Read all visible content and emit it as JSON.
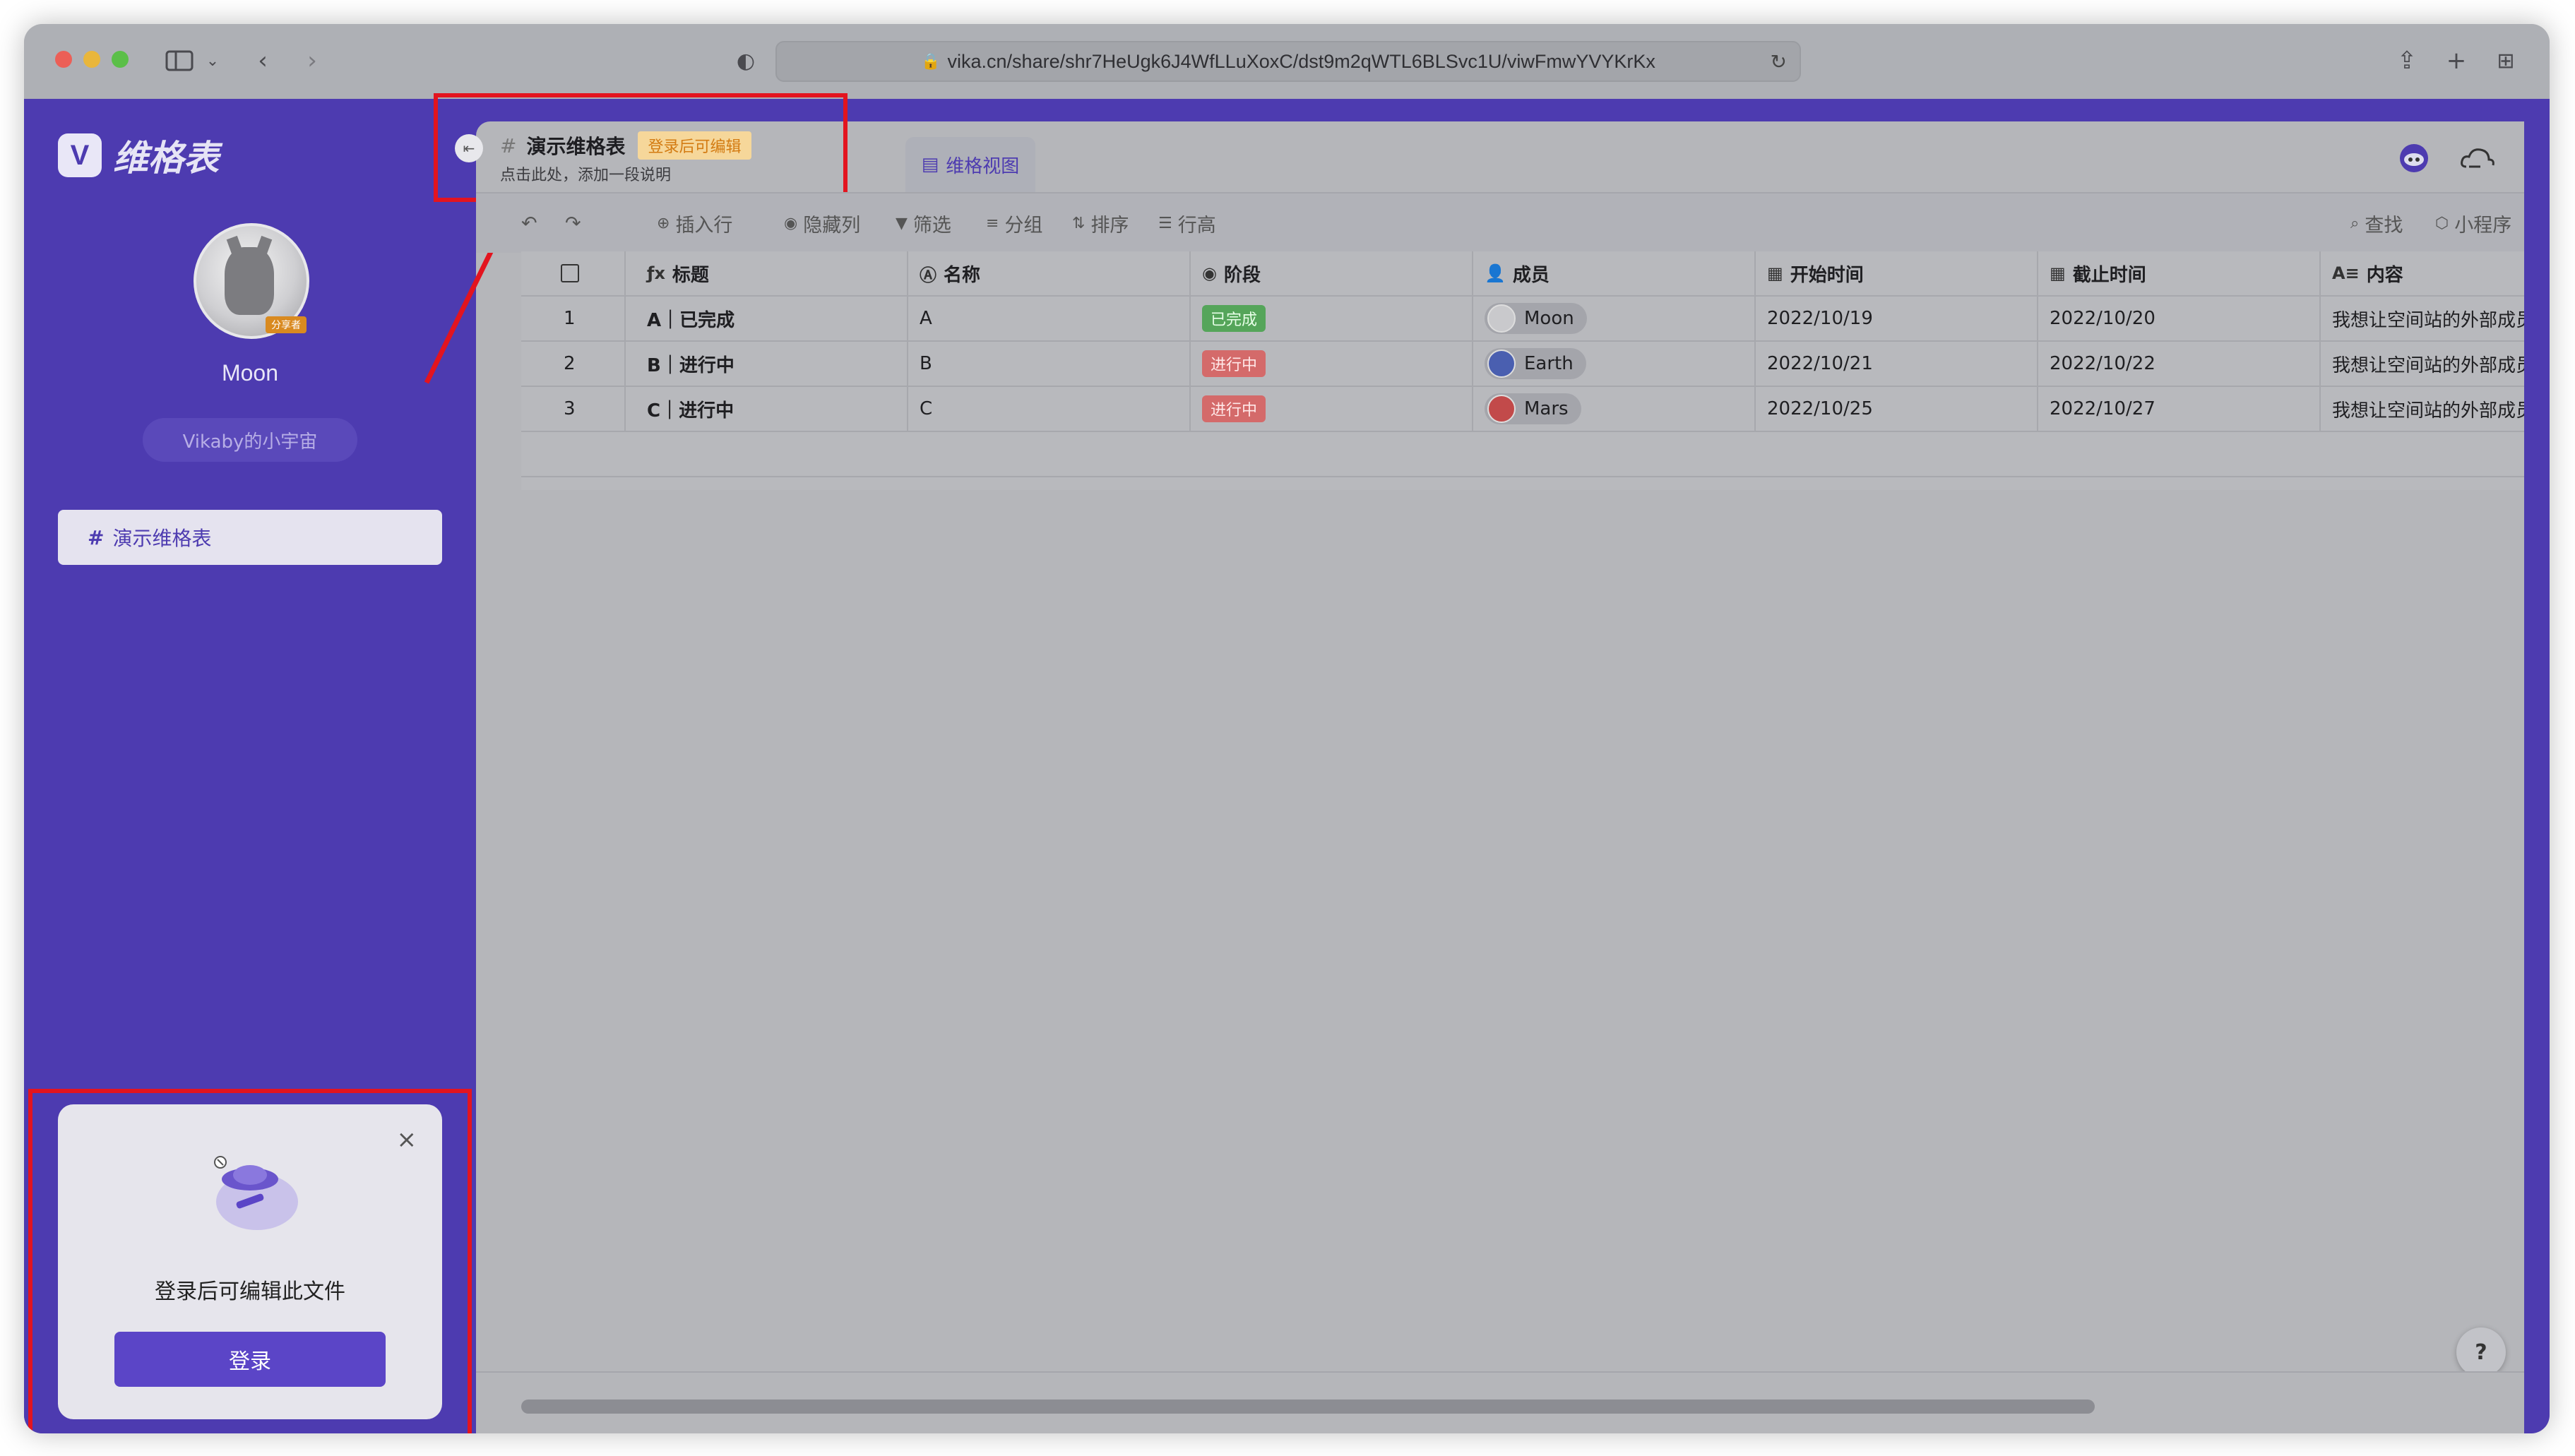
{
  "browser": {
    "url": "vika.cn/share/shr7HeUgk6J4WfLLuXoxC/dst9m2qWTL6BLSvc1U/viwFmwYVYKrKx",
    "traffic_colors": [
      "#ec5f57",
      "#e9b63b",
      "#5bbf48"
    ]
  },
  "sidebar": {
    "logo_text": "维格表",
    "logo_mark": "V",
    "avatar_badge": "分享者",
    "user_name": "Moon",
    "space_name": "Vikaby的小宇宙",
    "items": [
      {
        "icon": "#",
        "label": "演示维格表"
      }
    ]
  },
  "login_card": {
    "message": "登录后可编辑此文件",
    "button_label": "登录",
    "close": "×"
  },
  "sheet": {
    "title": "演示维格表",
    "edit_badge": "登录后可编辑",
    "description": "点击此处，添加一段说明",
    "view_tab": "维格视图"
  },
  "toolbar": {
    "insert_row": "插入行",
    "hide_columns": "隐藏列",
    "filter": "筛选",
    "group": "分组",
    "sort": "排序",
    "row_height": "行高",
    "search": "查找",
    "mini_program": "小程序"
  },
  "table": {
    "columns": [
      "标题",
      "名称",
      "阶段",
      "成员",
      "开始时间",
      "截止时间",
      "内容"
    ],
    "rows": [
      {
        "num": "1",
        "title": "A｜已完成",
        "name": "A",
        "stage": "已完成",
        "member": "Moon",
        "start": "2022/10/19",
        "end": "2022/10/20",
        "content": "我想让空间站的外部成员"
      },
      {
        "num": "2",
        "title": "B｜进行中",
        "name": "B",
        "stage": "进行中",
        "member": "Earth",
        "start": "2022/10/21",
        "end": "2022/10/22",
        "content": "我想让空间站的外部成员"
      },
      {
        "num": "3",
        "title": "C｜进行中",
        "name": "C",
        "stage": "进行中",
        "member": "Mars",
        "start": "2022/10/25",
        "end": "2022/10/27",
        "content": "我想让空间站的外部成员"
      }
    ]
  },
  "help": "?",
  "colors": {
    "brand_purple": "#4d3bb0",
    "annotation_red": "#e3141f",
    "done_green": "#55a55a",
    "doing_red": "#d46a6a"
  }
}
